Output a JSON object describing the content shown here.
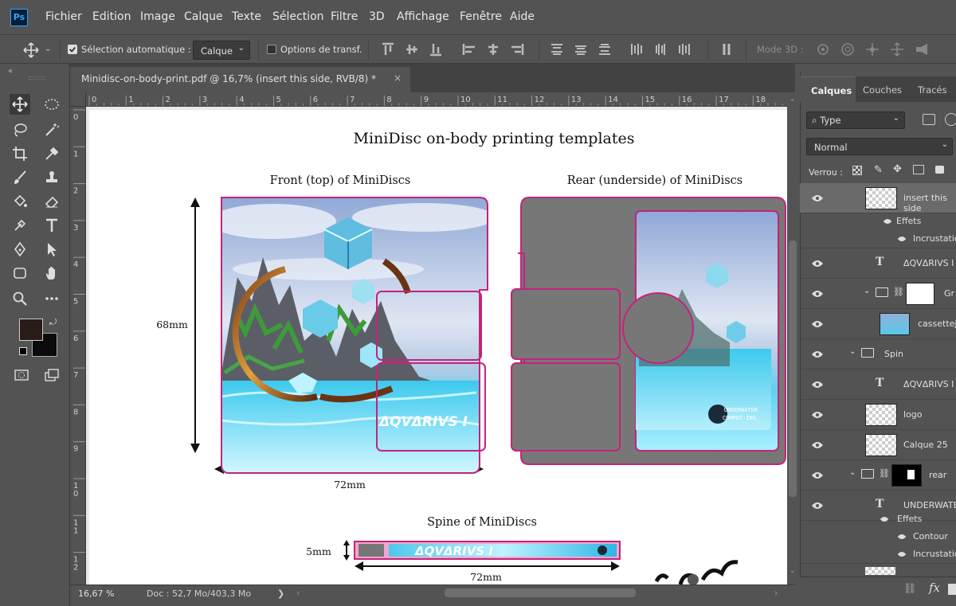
{
  "app": {
    "logo": "Ps"
  },
  "menu": [
    "Fichier",
    "Edition",
    "Image",
    "Calque",
    "Texte",
    "Sélection",
    "Filtre",
    "3D",
    "Affichage",
    "Fenêtre",
    "Aide"
  ],
  "options": {
    "auto_select": "Sélection automatique :",
    "target": "Calque",
    "transform": "Options de transf.",
    "mode3d": "Mode 3D :"
  },
  "document": {
    "tab_title": "Minidisc-on-body-print.pdf @ 16,7% (insert this side, RVB/8) *",
    "close": "×"
  },
  "ruler": {
    "top": [
      "0",
      "1",
      "2",
      "3",
      "4",
      "5",
      "6",
      "7",
      "8",
      "9",
      "10",
      "11",
      "12",
      "13",
      "14",
      "15",
      "16",
      "17",
      "18"
    ],
    "left": [
      "0",
      "1",
      "2",
      "3",
      "4",
      "5",
      "6",
      "7",
      "8",
      "9",
      "10",
      "11",
      "12"
    ]
  },
  "page": {
    "title": "MiniDisc on-body printing templates",
    "front_title": "Front (top) of MiniDiscs",
    "rear_title": "Rear (underside) of MiniDiscs",
    "spine_title": "Spine of MiniDiscs",
    "height_label": "68mm",
    "width_label": "72mm",
    "spine_height": "5mm",
    "spine_width": "72mm",
    "brand": "ΔQVΔRIVS I",
    "logo_line1": "UNDERWATER",
    "logo_line2": "COMPUT·ING_"
  },
  "status": {
    "zoom": "16,67 %",
    "doc": "Doc : 52,7 Mo/403,3 Mo",
    "arrow": "❯"
  },
  "panel": {
    "tabs": [
      "Calques",
      "Couches",
      "Tracés"
    ],
    "filter": "Type",
    "blend": "Normal",
    "lock": "Verrou :",
    "layers": [
      {
        "name": "insert this side",
        "kind": "thumb"
      },
      {
        "name": "Effets",
        "kind": "effects"
      },
      {
        "name": "Incrustation",
        "kind": "effect"
      },
      {
        "name": "ΔQVΔRIVS I",
        "kind": "text"
      },
      {
        "name": "Gr",
        "kind": "group"
      },
      {
        "name": "cassettejc",
        "kind": "image"
      },
      {
        "name": "Spin",
        "kind": "folder"
      },
      {
        "name": "ΔQVΔRIVS I",
        "kind": "text"
      },
      {
        "name": "logo",
        "kind": "thumb"
      },
      {
        "name": "Calque 25",
        "kind": "thumb"
      },
      {
        "name": "rear",
        "kind": "group"
      },
      {
        "name": "UNDERWATER",
        "kind": "text"
      },
      {
        "name": "Effets",
        "kind": "effects"
      },
      {
        "name": "Contour",
        "kind": "effect"
      },
      {
        "name": "Incrustation",
        "kind": "effect"
      }
    ],
    "footer_fx": "fx"
  },
  "colors": {
    "accent": "#31a8ff",
    "frame": "#c4237b",
    "panel_bg": "#535353"
  }
}
